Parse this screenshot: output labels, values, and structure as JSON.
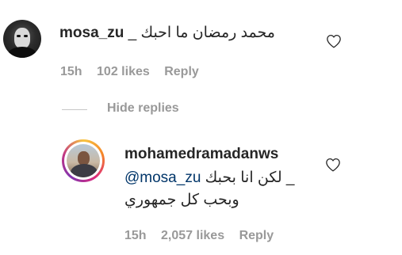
{
  "comment": {
    "username": "mosa_zu",
    "text": "محمد رمضان ما احبك _",
    "time": "15h",
    "likes": "102 likes",
    "reply_label": "Reply",
    "like_icon": "heart-outline-icon"
  },
  "replies_toggle": {
    "label": "Hide replies"
  },
  "reply": {
    "username": "mohamedramadanws",
    "mention": "@mosa_zu",
    "text_line1": "_ لكن انا بحبك",
    "text_line2": "وبحب كل جمهوري",
    "time": "15h",
    "likes": "2,057 likes",
    "reply_label": "Reply",
    "like_icon": "heart-outline-icon"
  },
  "colors": {
    "text": "#262626",
    "meta": "#999999",
    "mention": "#003569",
    "divider": "#c7c7c7"
  }
}
